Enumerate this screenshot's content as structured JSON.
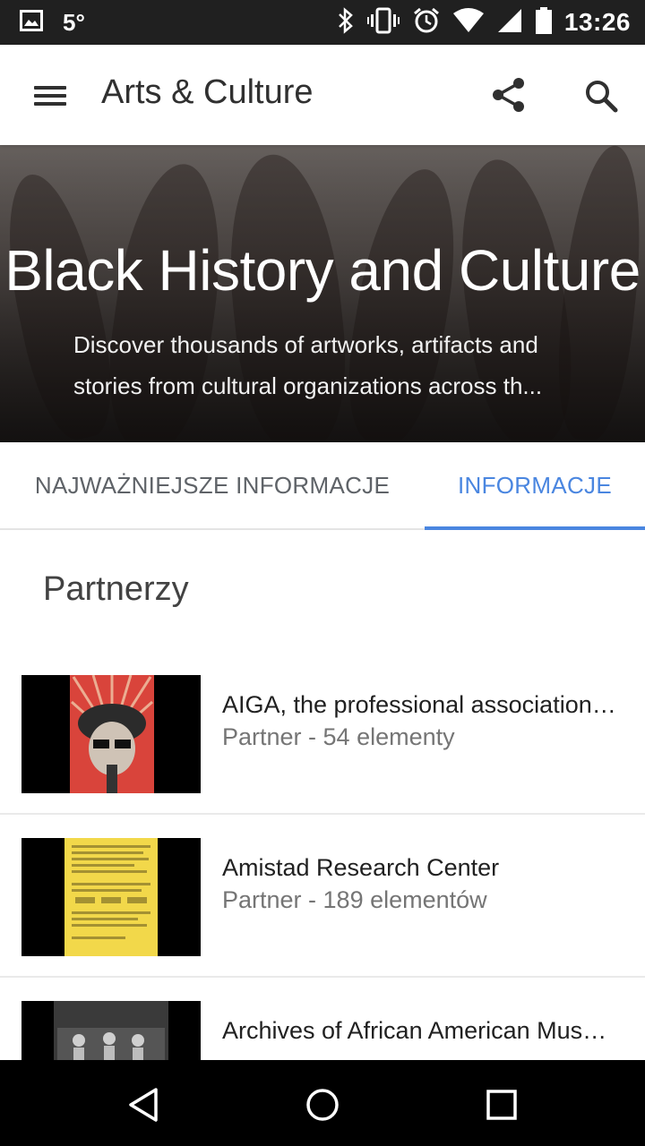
{
  "status": {
    "temperature": "5°",
    "time": "13:26"
  },
  "appbar": {
    "title": "Arts & Culture"
  },
  "hero": {
    "title": "Black History and Culture",
    "description": "Discover thousands of artworks, artifacts and stories from cultural organizations across th..."
  },
  "tabs": [
    {
      "label": "NAJWAŻNIEJSZE INFORMACJE",
      "active": false
    },
    {
      "label": "INFORMACJE",
      "active": true
    }
  ],
  "section": {
    "title": "Partnerzy"
  },
  "partners": [
    {
      "name": "AIGA, the professional association…",
      "meta": "Partner - 54 elementy"
    },
    {
      "name": "Amistad Research Center",
      "meta": "Partner - 189 elementów"
    },
    {
      "name": "Archives of African American Mus…",
      "meta": ""
    }
  ],
  "colors": {
    "accent": "#4a86e0",
    "statusbar": "#202020",
    "navbar": "#000000"
  },
  "icons": {
    "statusbar": [
      "image-icon",
      "bluetooth-icon",
      "vibrate-icon",
      "alarm-icon",
      "wifi-icon",
      "signal-icon",
      "battery-icon"
    ],
    "appbar": [
      "menu-icon",
      "share-icon",
      "search-icon"
    ],
    "navbar": [
      "back-icon",
      "home-icon",
      "recents-icon"
    ]
  }
}
